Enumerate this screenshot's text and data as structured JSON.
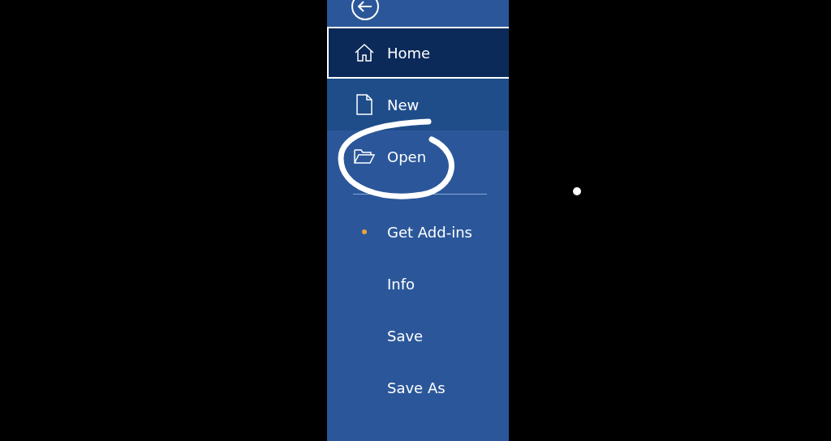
{
  "sidebar": {
    "items": [
      {
        "label": "Home",
        "kind": "home",
        "selected": true,
        "hovered": false,
        "notification": false
      },
      {
        "label": "New",
        "kind": "new",
        "selected": false,
        "hovered": true,
        "notification": false
      },
      {
        "label": "Open",
        "kind": "open",
        "selected": false,
        "hovered": false,
        "notification": false
      },
      {
        "label": "Get Add-ins",
        "kind": "divider-before",
        "selected": false,
        "hovered": false,
        "notification": true
      },
      {
        "label": "Info",
        "kind": "plain",
        "selected": false,
        "hovered": false,
        "notification": false
      },
      {
        "label": "Save",
        "kind": "plain",
        "selected": false,
        "hovered": false,
        "notification": false
      },
      {
        "label": "Save As",
        "kind": "plain",
        "selected": false,
        "hovered": false,
        "notification": false
      }
    ]
  }
}
